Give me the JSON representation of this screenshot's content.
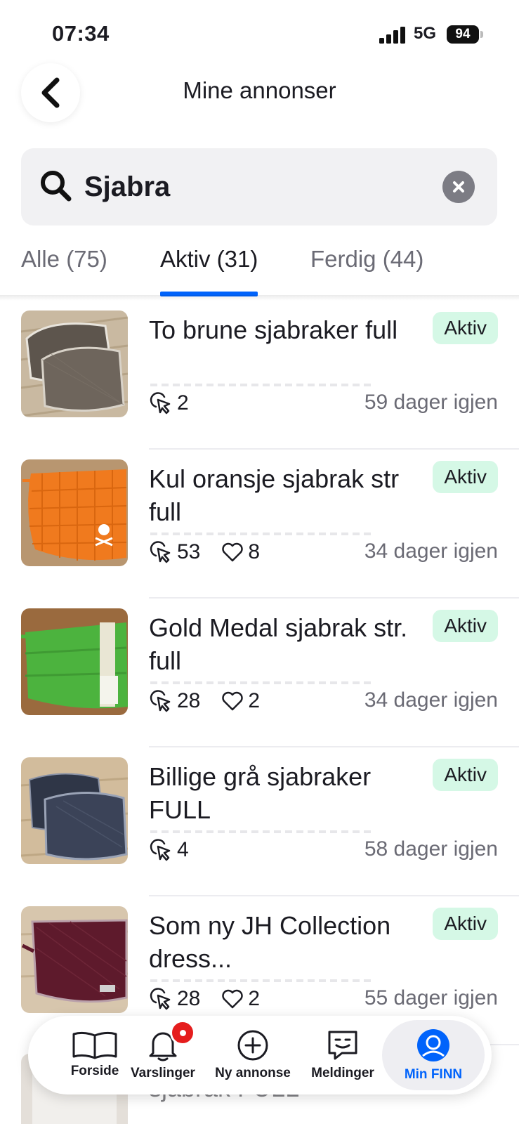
{
  "status_bar": {
    "time": "07:34",
    "network": "5G",
    "battery": "94"
  },
  "header": {
    "title": "Mine annonser"
  },
  "search": {
    "value": "Sjabra"
  },
  "tabs": [
    {
      "label": "Alle (75)",
      "active": false
    },
    {
      "label": "Aktiv (31)",
      "active": true
    },
    {
      "label": "Ferdig (44)",
      "active": false
    }
  ],
  "listings": [
    {
      "title": "To brune sjabraker full",
      "status": "Aktiv",
      "clicks": "2",
      "favorites": "",
      "days_left": "59 dager igjen",
      "thumb_color": "#6e655c"
    },
    {
      "title": "Kul oransje sjabrak str full",
      "status": "Aktiv",
      "clicks": "53",
      "favorites": "8",
      "days_left": "34 dager igjen",
      "thumb_color": "#f07a1e"
    },
    {
      "title": "Gold Medal sjabrak str. full",
      "status": "Aktiv",
      "clicks": "28",
      "favorites": "2",
      "days_left": "34 dager igjen",
      "thumb_color": "#4cb33e"
    },
    {
      "title": "Billige grå sjabraker FULL",
      "status": "Aktiv",
      "clicks": "4",
      "favorites": "",
      "days_left": "58 dager igjen",
      "thumb_color": "#3b4358"
    },
    {
      "title": "Som ny JH Collection dress...",
      "status": "Aktiv",
      "clicks": "28",
      "favorites": "2",
      "days_left": "55 dager igjen",
      "thumb_color": "#5e1a2c"
    }
  ],
  "partial_listing": {
    "title": "sjabrak FULL"
  },
  "bottom_nav": [
    {
      "label": "Forside",
      "icon": "book-icon",
      "active": false
    },
    {
      "label": "Varslinger",
      "icon": "bell-icon",
      "active": false
    },
    {
      "label": "Ny annonse",
      "icon": "plus-circle-icon",
      "active": false
    },
    {
      "label": "Meldinger",
      "icon": "chat-icon",
      "active": false
    },
    {
      "label": "Min FINN",
      "icon": "user-icon",
      "active": true
    }
  ],
  "colors": {
    "accent": "#0063fb",
    "badge_bg": "#d5f8e6",
    "notification": "#e51d1d"
  }
}
